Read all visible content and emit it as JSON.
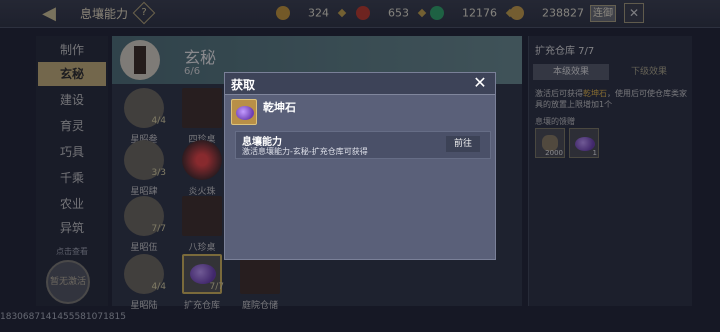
{
  "topbar": {
    "title": "息壤能力",
    "help_label": "?",
    "back_glyph": "◀",
    "resources": [
      {
        "icon": "copper-coin-icon",
        "color": "#c99a3a",
        "value": "324"
      },
      {
        "icon": "red-gem-icon",
        "color": "#c0392b",
        "value": "653"
      },
      {
        "icon": "green-jade-icon",
        "color": "#2ea86a",
        "value": "12176"
      },
      {
        "icon": "gold-ingot-icon",
        "color": "#caa04a",
        "value": "238827"
      }
    ],
    "recharge_label": "连御",
    "close_glyph": "✕"
  },
  "leftmenu": {
    "items": [
      "制作",
      "玄秘",
      "建设",
      "育灵",
      "巧具",
      "千乘",
      "农业",
      "异筑"
    ],
    "active_index": 1,
    "view_hint": "点击查看",
    "seal_label": "暂无激活"
  },
  "banner": {
    "title": "玄秘",
    "progress": "6/6"
  },
  "grid": {
    "items": [
      {
        "name": "星昭叁",
        "count": "4/4"
      },
      {
        "name": "四珍桌",
        "count": ""
      },
      {
        "name": "星昭肆",
        "count": "3/3"
      },
      {
        "name": "炎火珠",
        "count": ""
      },
      {
        "name": "星昭伍",
        "count": "7/7"
      },
      {
        "name": "八珍桌",
        "count": ""
      },
      {
        "name": "星昭陆",
        "count": "4/4"
      },
      {
        "name": "扩充仓库",
        "count": "7/7"
      },
      {
        "name": "庭院仓储",
        "count": ""
      }
    ]
  },
  "rightpanel": {
    "title": "扩充仓库 7/7",
    "tab_active": "本级效果",
    "tab_inactive": "下级效果",
    "desc_pre": "激活后可获得",
    "desc_highlight": "乾坤石",
    "desc_post": "，使用后可使仓库类家具的放置上限增加1个",
    "sub_title": "息壤的馈赠",
    "rewards": [
      {
        "icon": "stone-ore-icon",
        "qty": "2000"
      },
      {
        "icon": "qiankun-stone-icon",
        "qty": "1"
      }
    ]
  },
  "player_id": "1830687141455581071815",
  "modal": {
    "title": "获取",
    "close_glyph": "✕",
    "item_name": "乾坤石",
    "source_title": "息壤能力",
    "source_desc": "激活息壤能力-玄秘-扩充仓库可获得",
    "goto_label": "前往"
  }
}
